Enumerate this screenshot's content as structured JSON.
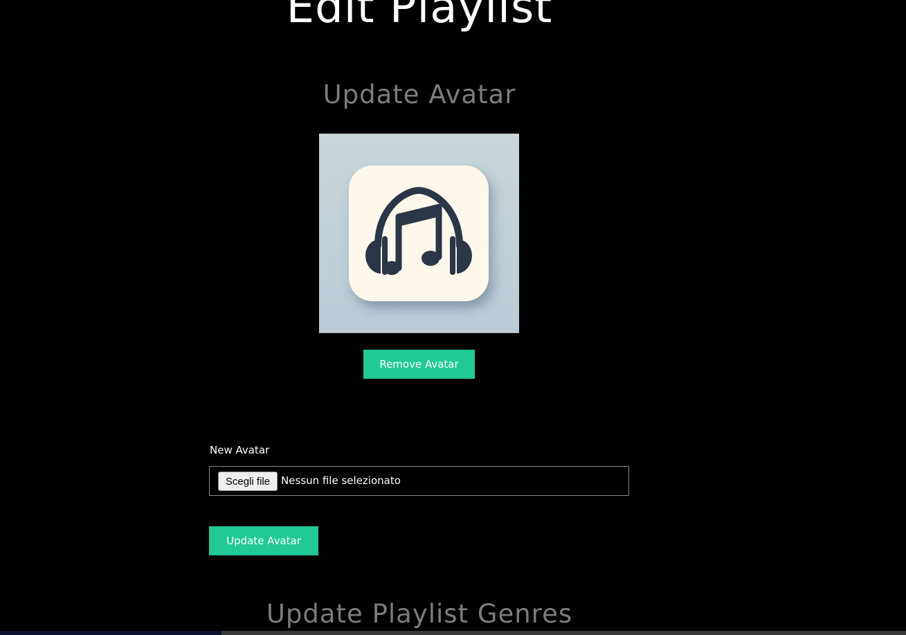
{
  "page": {
    "title": "Edit Playlist"
  },
  "avatar_section": {
    "title": "Update Avatar",
    "remove_button_label": "Remove Avatar",
    "avatar_image": "headphones-music-note-icon",
    "new_avatar_label": "New Avatar",
    "file_input": {
      "button_label": "Scegli file",
      "status_text": "Nessun file selezionato"
    },
    "update_button_label": "Update Avatar"
  },
  "genres_section": {
    "title": "Update Playlist Genres"
  },
  "colors": {
    "background": "#000000",
    "accent": "#21c997",
    "heading": "#ffffff",
    "subheading": "#7c7c7c"
  }
}
